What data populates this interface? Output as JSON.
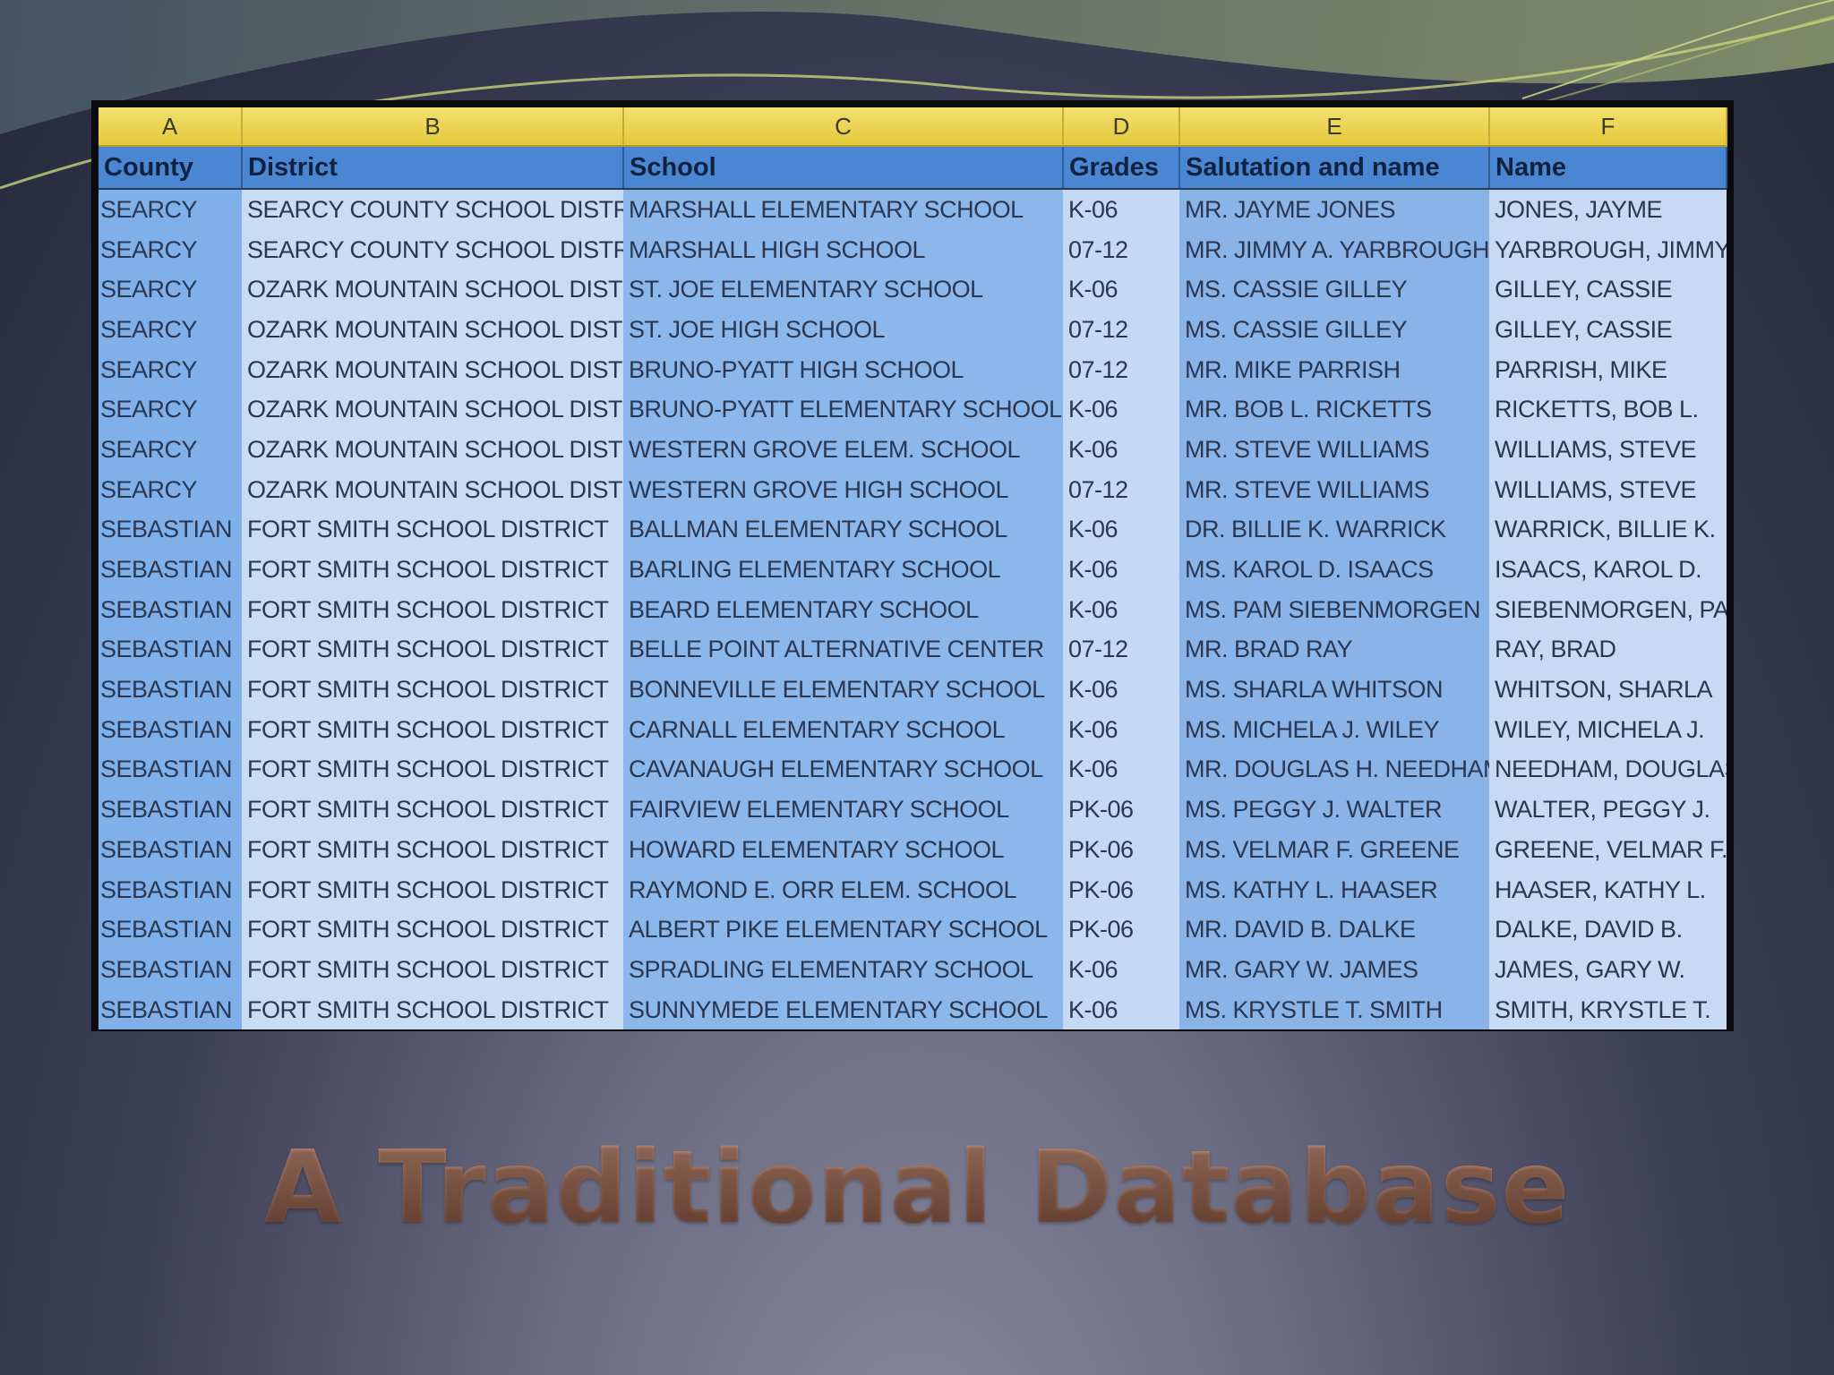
{
  "slide": {
    "title": "A Traditional Database",
    "colors": {
      "header_row": "#4a86d2",
      "column_letters": "#e4c93a",
      "title": "#8a5a48"
    }
  },
  "sheet": {
    "column_letters": [
      "A",
      "B",
      "C",
      "D",
      "E",
      "F"
    ],
    "headers": [
      "County",
      "District",
      "School",
      "Grades",
      "Salutation and name",
      "Name"
    ],
    "rows": [
      [
        "SEARCY",
        "SEARCY COUNTY SCHOOL DISTRIC",
        "MARSHALL ELEMENTARY SCHOOL",
        "K-06",
        "MR. JAYME JONES",
        "JONES, JAYME"
      ],
      [
        "SEARCY",
        "SEARCY COUNTY SCHOOL DISTRIC",
        "MARSHALL HIGH SCHOOL",
        "07-12",
        "MR. JIMMY A. YARBROUGH",
        "YARBROUGH, JIMMY A"
      ],
      [
        "SEARCY",
        "OZARK MOUNTAIN SCHOOL DISTRI",
        "ST. JOE ELEMENTARY SCHOOL",
        "K-06",
        "MS. CASSIE GILLEY",
        "GILLEY, CASSIE"
      ],
      [
        "SEARCY",
        "OZARK MOUNTAIN SCHOOL DISTRI",
        "ST. JOE HIGH SCHOOL",
        "07-12",
        "MS. CASSIE GILLEY",
        "GILLEY, CASSIE"
      ],
      [
        "SEARCY",
        "OZARK MOUNTAIN SCHOOL DISTRI",
        "BRUNO-PYATT HIGH SCHOOL",
        "07-12",
        "MR. MIKE PARRISH",
        "PARRISH, MIKE"
      ],
      [
        "SEARCY",
        "OZARK MOUNTAIN SCHOOL DISTRI",
        "BRUNO-PYATT ELEMENTARY SCHOOL",
        "K-06",
        "MR. BOB L. RICKETTS",
        "RICKETTS, BOB L."
      ],
      [
        "SEARCY",
        "OZARK MOUNTAIN SCHOOL DISTRI",
        "WESTERN GROVE ELEM. SCHOOL",
        "K-06",
        "MR. STEVE WILLIAMS",
        "WILLIAMS, STEVE"
      ],
      [
        "SEARCY",
        "OZARK MOUNTAIN SCHOOL DISTRI",
        "WESTERN GROVE HIGH SCHOOL",
        "07-12",
        "MR. STEVE WILLIAMS",
        "WILLIAMS, STEVE"
      ],
      [
        "SEBASTIAN",
        "FORT SMITH SCHOOL DISTRICT",
        "BALLMAN ELEMENTARY SCHOOL",
        "K-06",
        "DR. BILLIE K. WARRICK",
        "WARRICK, BILLIE K."
      ],
      [
        "SEBASTIAN",
        "FORT SMITH SCHOOL DISTRICT",
        "BARLING ELEMENTARY SCHOOL",
        "K-06",
        "MS. KAROL D. ISAACS",
        "ISAACS, KAROL D."
      ],
      [
        "SEBASTIAN",
        "FORT SMITH SCHOOL DISTRICT",
        "BEARD ELEMENTARY SCHOOL",
        "K-06",
        "MS. PAM SIEBENMORGEN",
        "SIEBENMORGEN, PAM"
      ],
      [
        "SEBASTIAN",
        "FORT SMITH SCHOOL DISTRICT",
        "BELLE POINT ALTERNATIVE CENTER",
        "07-12",
        "MR. BRAD RAY",
        "RAY, BRAD"
      ],
      [
        "SEBASTIAN",
        "FORT SMITH SCHOOL DISTRICT",
        "BONNEVILLE ELEMENTARY SCHOOL",
        "K-06",
        "MS. SHARLA WHITSON",
        "WHITSON, SHARLA"
      ],
      [
        "SEBASTIAN",
        "FORT SMITH SCHOOL DISTRICT",
        "CARNALL ELEMENTARY SCHOOL",
        "K-06",
        "MS. MICHELA J. WILEY",
        "WILEY, MICHELA J."
      ],
      [
        "SEBASTIAN",
        "FORT SMITH SCHOOL DISTRICT",
        "CAVANAUGH ELEMENTARY SCHOOL",
        "K-06",
        "MR. DOUGLAS H. NEEDHAM",
        "NEEDHAM, DOUGLAS"
      ],
      [
        "SEBASTIAN",
        "FORT SMITH SCHOOL DISTRICT",
        "FAIRVIEW ELEMENTARY SCHOOL",
        "PK-06",
        "MS. PEGGY J. WALTER",
        "WALTER, PEGGY J."
      ],
      [
        "SEBASTIAN",
        "FORT SMITH SCHOOL DISTRICT",
        "HOWARD ELEMENTARY SCHOOL",
        "PK-06",
        "MS. VELMAR F. GREENE",
        "GREENE, VELMAR F."
      ],
      [
        "SEBASTIAN",
        "FORT SMITH SCHOOL DISTRICT",
        "RAYMOND E. ORR ELEM. SCHOOL",
        "PK-06",
        "MS. KATHY L. HAASER",
        "HAASER, KATHY L."
      ],
      [
        "SEBASTIAN",
        "FORT SMITH SCHOOL DISTRICT",
        "ALBERT PIKE ELEMENTARY SCHOOL",
        "PK-06",
        "MR. DAVID B. DALKE",
        "DALKE, DAVID B."
      ],
      [
        "SEBASTIAN",
        "FORT SMITH SCHOOL DISTRICT",
        "SPRADLING ELEMENTARY SCHOOL",
        "K-06",
        "MR. GARY W. JAMES",
        "JAMES, GARY W."
      ],
      [
        "SEBASTIAN",
        "FORT SMITH SCHOOL DISTRICT",
        "SUNNYMEDE ELEMENTARY SCHOOL",
        "K-06",
        "MS. KRYSTLE T. SMITH",
        "SMITH, KRYSTLE T."
      ]
    ]
  }
}
